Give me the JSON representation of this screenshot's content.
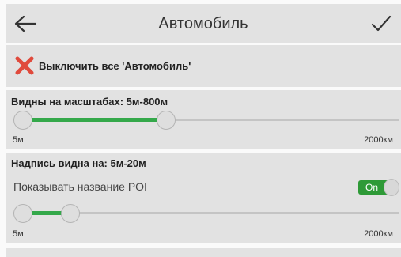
{
  "header": {
    "title": "Автомобиль",
    "back_icon": "arrow-left-icon",
    "confirm_icon": "checkmark-icon"
  },
  "disable_row": {
    "label": "Выключить все 'Автомобиль'",
    "icon": "red-x-icon",
    "icon_color": "#e04a3c"
  },
  "zoom_section": {
    "title": "Видны на масштабах: 5м-800м",
    "slider": {
      "min_label": "5м",
      "max_label": "2000км",
      "low_fraction": 0.0,
      "high_fraction": 0.39
    }
  },
  "label_section": {
    "title": "Надпись видна на: 5м-20м",
    "poi_label": "Показывать название POI",
    "toggle": {
      "state": "On",
      "color": "#2e9a37"
    },
    "slider": {
      "min_label": "5м",
      "max_label": "2000км",
      "low_fraction": 0.0,
      "high_fraction": 0.13
    }
  },
  "colors": {
    "accent": "#34a84a",
    "panel": "#e2e2e2",
    "rail": "#c4c4c4"
  }
}
